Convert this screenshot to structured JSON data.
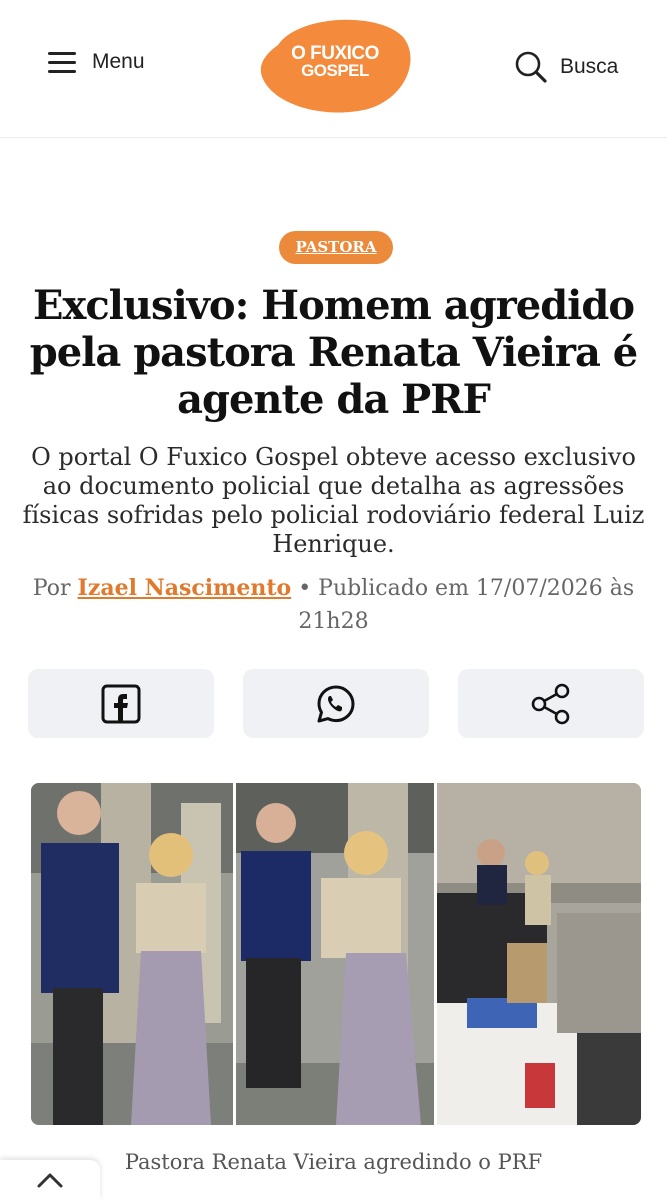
{
  "header": {
    "menu_label": "Menu",
    "logo_line1": "O FUXICO",
    "logo_line2": "GOSPEL",
    "search_label": "Busca",
    "brand_color": "#f48a3c"
  },
  "article": {
    "category": "PASTORA",
    "title": "Exclusivo: Homem agredido pela pastora Renata Vieira é agente da PRF",
    "subtitle": "O portal O Fuxico Gospel obteve acesso exclusivo ao documento policial que detalha as agressões físicas sofridas pelo policial rodoviário federal Luiz Henrique.",
    "byline": {
      "prefix": "Por",
      "author": "Izael Nascimento",
      "published": "• Publicado em 17/07/2026 às 21h28"
    },
    "share_buttons": [
      {
        "icon": "facebook-icon"
      },
      {
        "icon": "whatsapp-icon"
      },
      {
        "icon": "share-icon"
      }
    ],
    "image_caption": "Pastora Renata Vieira agredindo o PRF"
  },
  "footer": {
    "back_to_top_icon": "chevron-up-icon"
  }
}
